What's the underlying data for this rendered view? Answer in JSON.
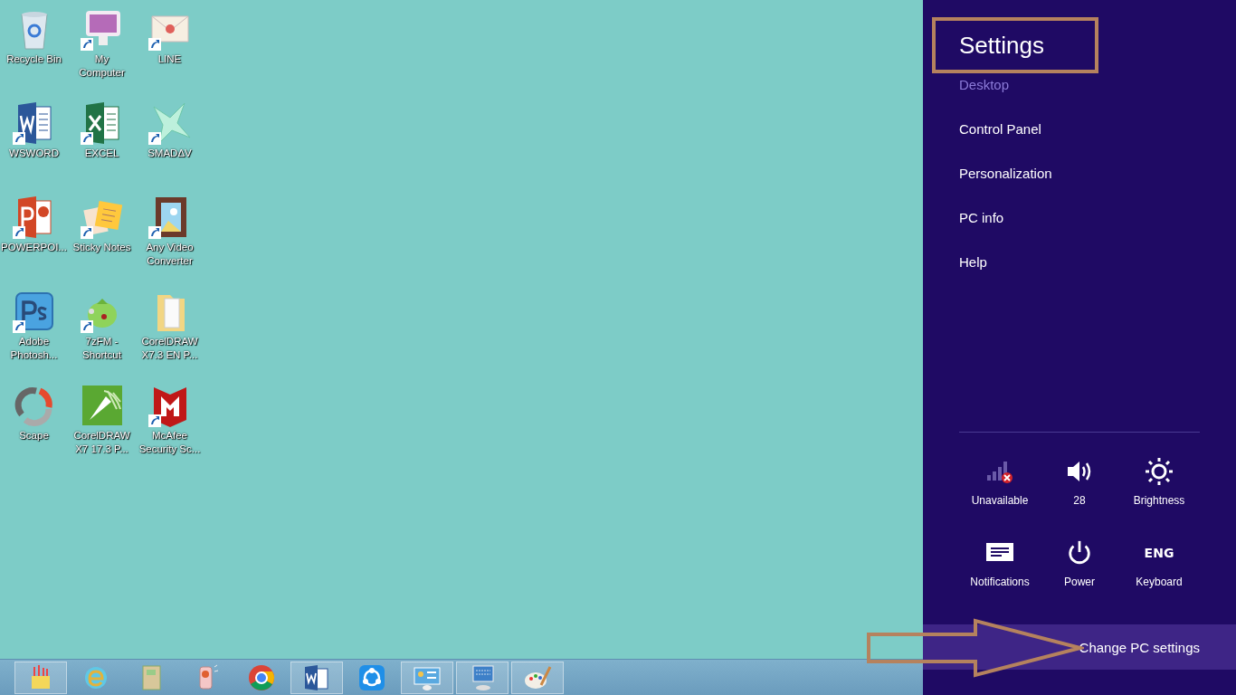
{
  "desktop_icons": [
    {
      "label": "Recycle Bin",
      "kind": "recycle-bin",
      "shortcut": false
    },
    {
      "label": "My\nComputer",
      "kind": "monitor",
      "shortcut": true
    },
    {
      "label": "LINE",
      "kind": "envelope",
      "shortcut": true
    },
    {
      "label": "WSWORD",
      "kind": "word",
      "shortcut": true
    },
    {
      "label": "EXCEL",
      "kind": "excel",
      "shortcut": true
    },
    {
      "label": "SMADΔV",
      "kind": "star-x",
      "shortcut": true
    },
    {
      "label": "POWERPOI...",
      "kind": "powerpoint",
      "shortcut": true
    },
    {
      "label": "Sticky Notes",
      "kind": "notes",
      "shortcut": true
    },
    {
      "label": "Any Video\nConverter",
      "kind": "film",
      "shortcut": true
    },
    {
      "label": "Adobe\nPhotosh...",
      "kind": "ps",
      "shortcut": true
    },
    {
      "label": "7zFM -\nShortcut",
      "kind": "teapot",
      "shortcut": true
    },
    {
      "label": "CorelDRAW\nX7.3 EN P...",
      "kind": "folder",
      "shortcut": false
    },
    {
      "label": "Scape",
      "kind": "ring",
      "shortcut": false
    },
    {
      "label": "CorelDRAW\nX7 17.3 P...",
      "kind": "nib",
      "shortcut": false
    },
    {
      "label": "McAfee\nSecurity Sc...",
      "kind": "shield",
      "shortcut": true
    }
  ],
  "taskbar": [
    {
      "kind": "crayons",
      "running": true
    },
    {
      "kind": "browser-e",
      "running": false
    },
    {
      "kind": "book",
      "running": false
    },
    {
      "kind": "phone",
      "running": false
    },
    {
      "kind": "chrome",
      "running": false
    },
    {
      "kind": "word",
      "running": true
    },
    {
      "kind": "share",
      "running": false
    },
    {
      "kind": "panel",
      "running": true
    },
    {
      "kind": "computer",
      "running": true
    },
    {
      "kind": "palette",
      "running": true
    }
  ],
  "settings_panel": {
    "title": "Settings",
    "subtitle": "Desktop",
    "items": [
      "Control Panel",
      "Personalization",
      "PC info",
      "Help"
    ],
    "quick_settings": [
      {
        "kind": "network",
        "label": "Unavailable"
      },
      {
        "kind": "volume",
        "label": "28"
      },
      {
        "kind": "brightness",
        "label": "Brightness"
      },
      {
        "kind": "notifications",
        "label": "Notifications"
      },
      {
        "kind": "power",
        "label": "Power"
      },
      {
        "kind": "keyboard",
        "label": "Keyboard",
        "glyph": "ENG"
      }
    ],
    "footer_link": {
      "label": "Change PC settings",
      "highlighted": true
    }
  }
}
